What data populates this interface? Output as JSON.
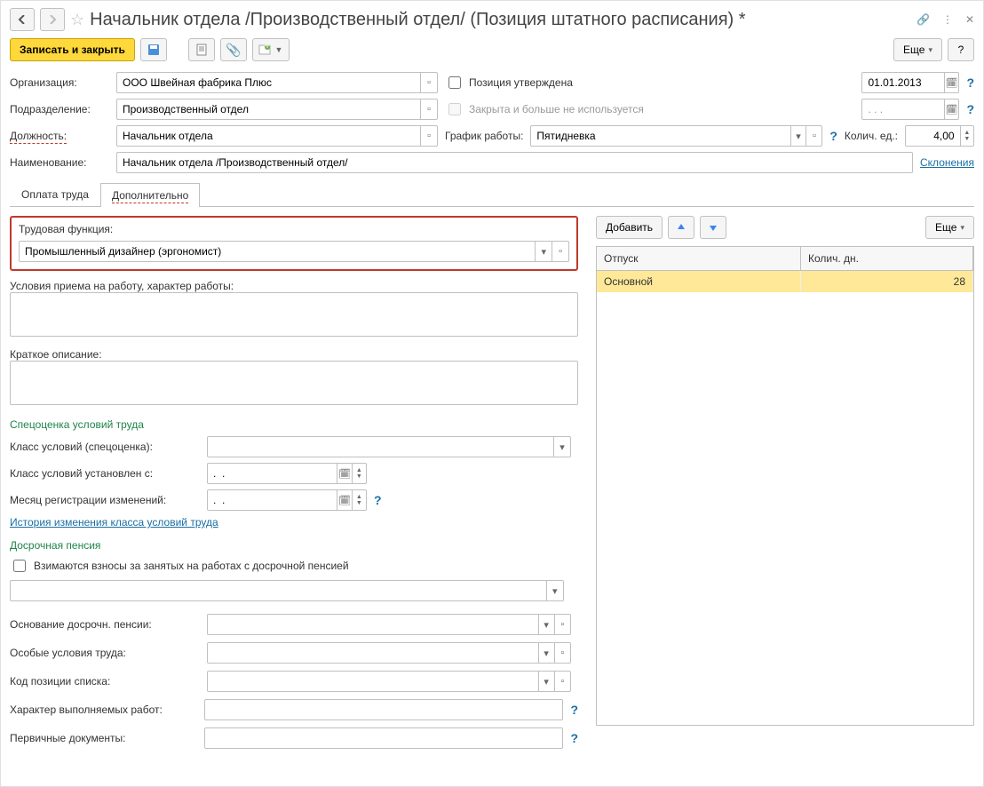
{
  "title": "Начальник отдела /Производственный отдел/ (Позиция штатного расписания) *",
  "toolbar": {
    "write_close": "Записать и закрыть",
    "more": "Еще"
  },
  "labels": {
    "org": "Организация:",
    "dept": "Подразделение:",
    "position": "Должность:",
    "name": "Наименование:",
    "schedule": "График работы:",
    "count": "Колич. ед.:",
    "approved": "Позиция утверждена",
    "closed": "Закрыта и больше не используется",
    "declension": "Склонения"
  },
  "values": {
    "org": "ООО Швейная фабрика Плюс",
    "dept": "Производственный отдел",
    "position": "Начальник отдела",
    "name": "Начальник отдела /Производственный отдел/",
    "schedule": "Пятидневка",
    "count": "4,00",
    "date1": "01.01.2013",
    "date2": ". . ."
  },
  "tabs": {
    "pay": "Оплата труда",
    "extra": "Дополнительно"
  },
  "extra": {
    "labor_func_label": "Трудовая функция:",
    "labor_func": "Промышленный дизайнер (эргономист)",
    "hire_cond": "Условия приема на работу, характер работы:",
    "short_desc": "Краткое описание:",
    "spec_title": "Спецоценка условий труда",
    "class_label": "Класс условий (спецоценка):",
    "class_date": "Класс условий установлен с:",
    "class_date_val": ".  .",
    "reg_month": "Месяц регистрации изменений:",
    "reg_month_val": ".  .",
    "history_link": "История изменения класса условий труда",
    "pension_title": "Досрочная пенсия",
    "pension_check": "Взимаются взносы за занятых на работах с досрочной пенсией",
    "pension_basis": "Основание досрочн. пенсии:",
    "special_cond": "Особые условия труда:",
    "list_code": "Код позиции списка:",
    "work_char": "Характер выполняемых работ:",
    "prim_docs": "Первичные документы:"
  },
  "vacation": {
    "add": "Добавить",
    "more": "Еще",
    "col1": "Отпуск",
    "col2": "Колич. дн.",
    "rows": [
      {
        "name": "Основной",
        "days": "28"
      }
    ]
  },
  "help": "?"
}
